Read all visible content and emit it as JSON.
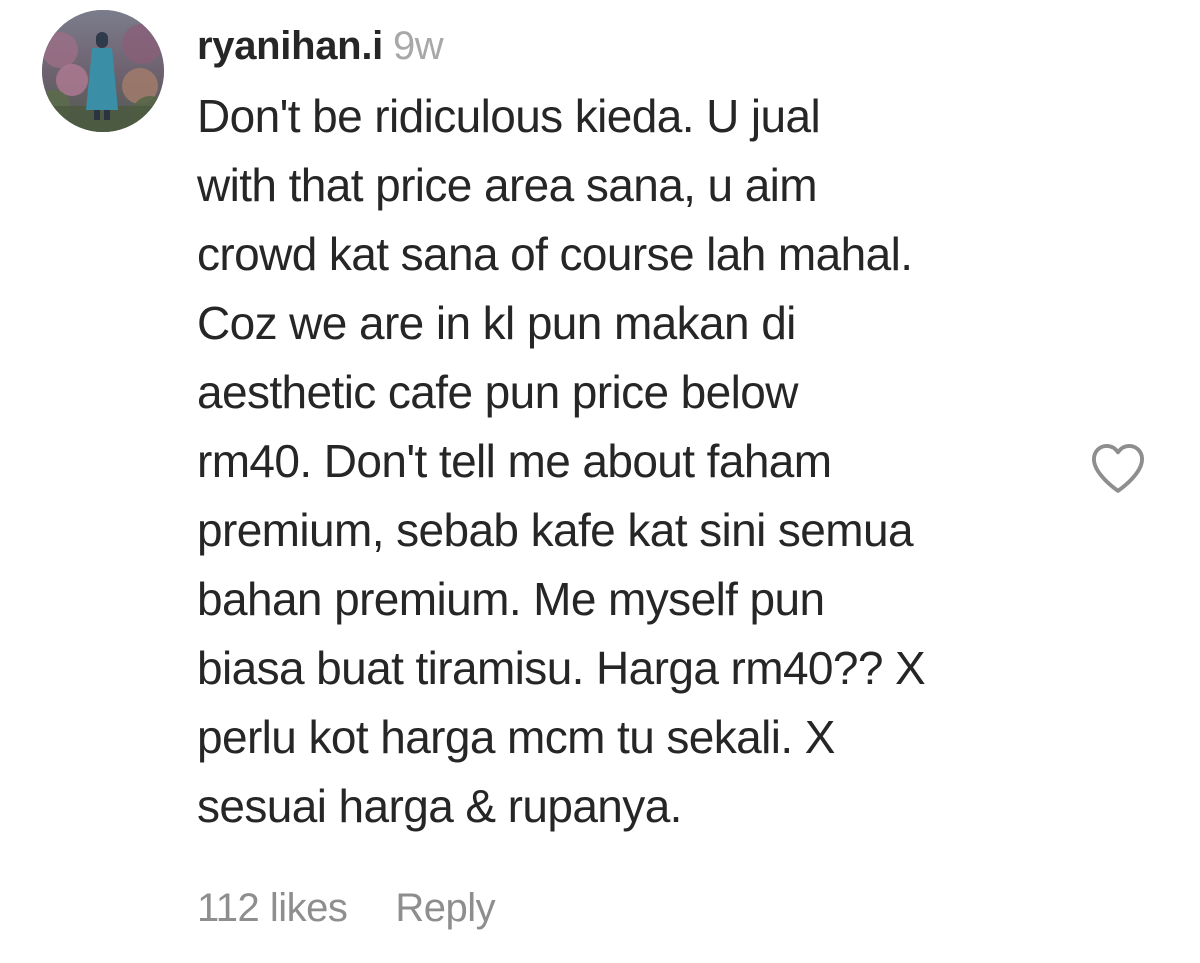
{
  "comment": {
    "username": "ryanihan.i",
    "time_ago": "9w",
    "text_lines": [
      "Don't be ridiculous kieda. U jual",
      "with that price area sana, u aim",
      "crowd kat sana of course lah mahal.",
      "Coz we are in kl pun makan di",
      "aesthetic cafe pun price below",
      "rm40. Don't tell me about faham",
      "premium, sebab kafe kat sini semua",
      "bahan premium. Me myself pun",
      "biasa buat tiramisu. Harga rm40?? X",
      "perlu kot harga mcm tu sekali. X",
      "sesuai harga & rupanya."
    ],
    "likes_label": "112 likes",
    "reply_label": "Reply",
    "like_icon": "heart-outline-icon",
    "avatar_icon": "user-avatar"
  },
  "colors": {
    "text": "#262626",
    "secondary": "#8e8e8e",
    "time": "#a8a8a8",
    "heart": "#8e8e8e"
  }
}
